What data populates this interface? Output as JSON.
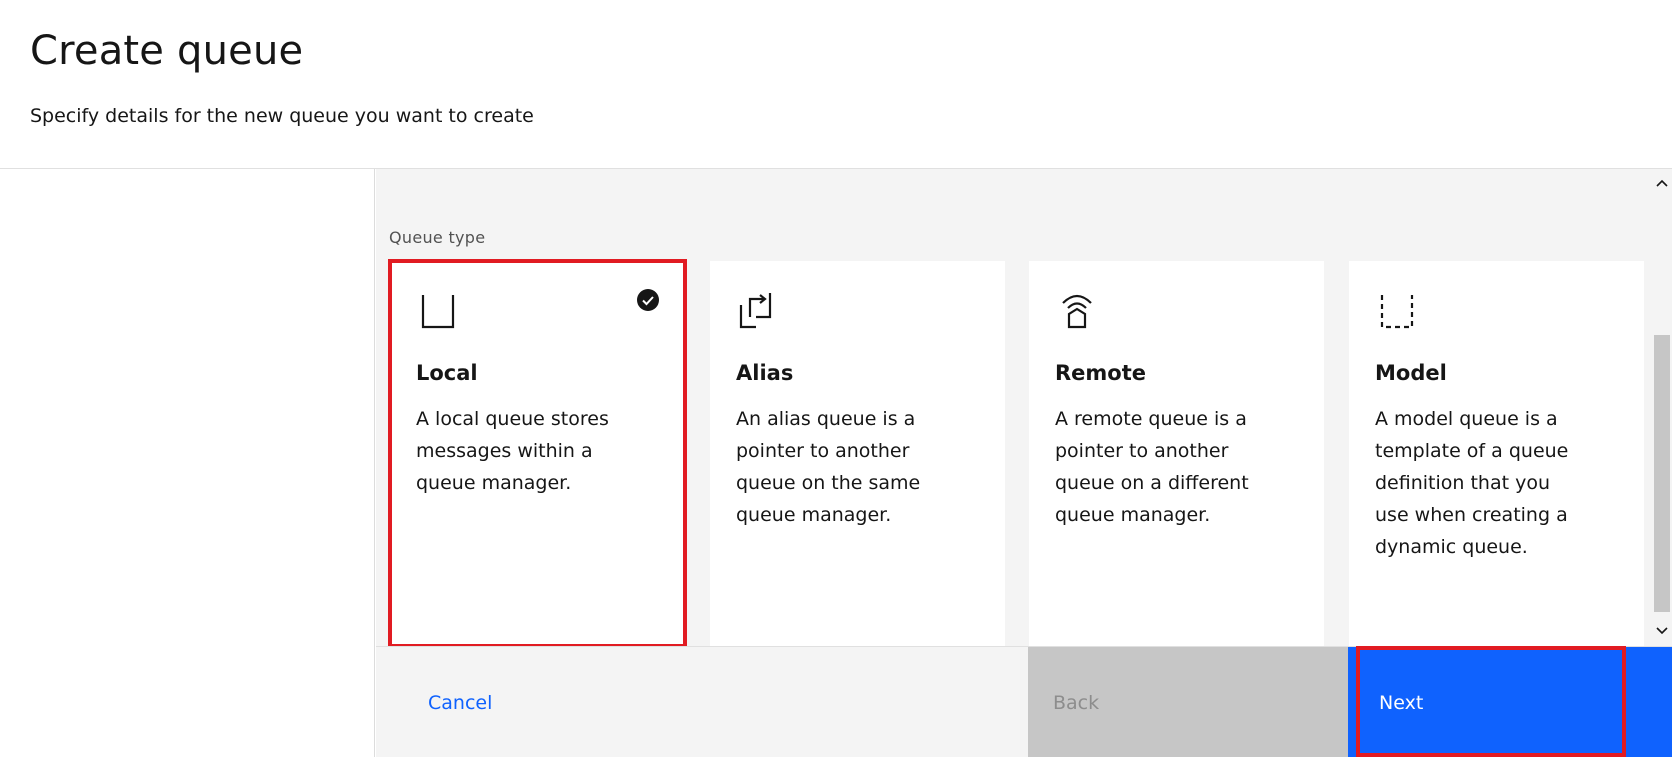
{
  "header": {
    "title": "Create queue",
    "subtitle": "Specify details for the new queue you want to create"
  },
  "section": {
    "label": "Queue type"
  },
  "tiles": [
    {
      "icon": "local-queue-icon",
      "title": "Local",
      "description": "A local queue stores messages within a queue manager.",
      "selected": true
    },
    {
      "icon": "alias-queue-icon",
      "title": "Alias",
      "description": "An alias queue is a pointer to another queue on the same queue manager.",
      "selected": false
    },
    {
      "icon": "remote-queue-icon",
      "title": "Remote",
      "description": "A remote queue is a pointer to another queue on a different queue manager.",
      "selected": false
    },
    {
      "icon": "model-queue-icon",
      "title": "Model",
      "description": "A model queue is a template of a queue definition that you use when creating a dynamic queue.",
      "selected": false
    }
  ],
  "footer": {
    "cancel_label": "Cancel",
    "back_label": "Back",
    "next_label": "Next"
  },
  "colors": {
    "accent": "#0f62fe",
    "highlight": "#e11b22",
    "disabled": "#c6c6c6"
  }
}
